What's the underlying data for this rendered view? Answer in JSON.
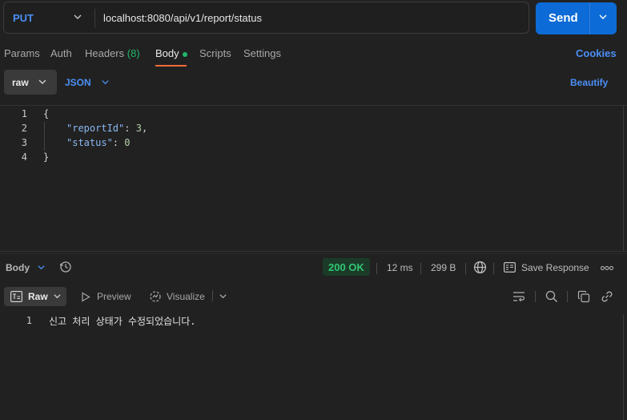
{
  "request": {
    "method": "PUT",
    "url": "localhost:8080/api/v1/report/status",
    "send_label": "Send"
  },
  "tabs": {
    "params": "Params",
    "auth": "Auth",
    "headers": "Headers",
    "headers_count": "(8)",
    "body": "Body",
    "scripts": "Scripts",
    "settings": "Settings",
    "cookies": "Cookies"
  },
  "body_options": {
    "mode": "raw",
    "format": "JSON",
    "beautify": "Beautify"
  },
  "editor": {
    "lines": [
      "1",
      "2",
      "3",
      "4"
    ],
    "open_brace": "{",
    "close_brace": "}",
    "key1": "\"reportId\"",
    "val1": "3",
    "key2": "\"status\"",
    "val2": "0"
  },
  "response": {
    "label": "Body",
    "status": "200 OK",
    "time": "12 ms",
    "size": "299 B",
    "save": "Save Response",
    "more": "ooo",
    "views": {
      "raw": "Raw",
      "preview": "Preview",
      "visualize": "Visualize"
    },
    "line_number": "1",
    "content": "신고 처리 상태가 수정되었습니다."
  },
  "colors": {
    "accent": "#0c6bd6",
    "link": "#4b8ff5",
    "success": "#2fc774",
    "active_tab": "#f26b3a"
  }
}
